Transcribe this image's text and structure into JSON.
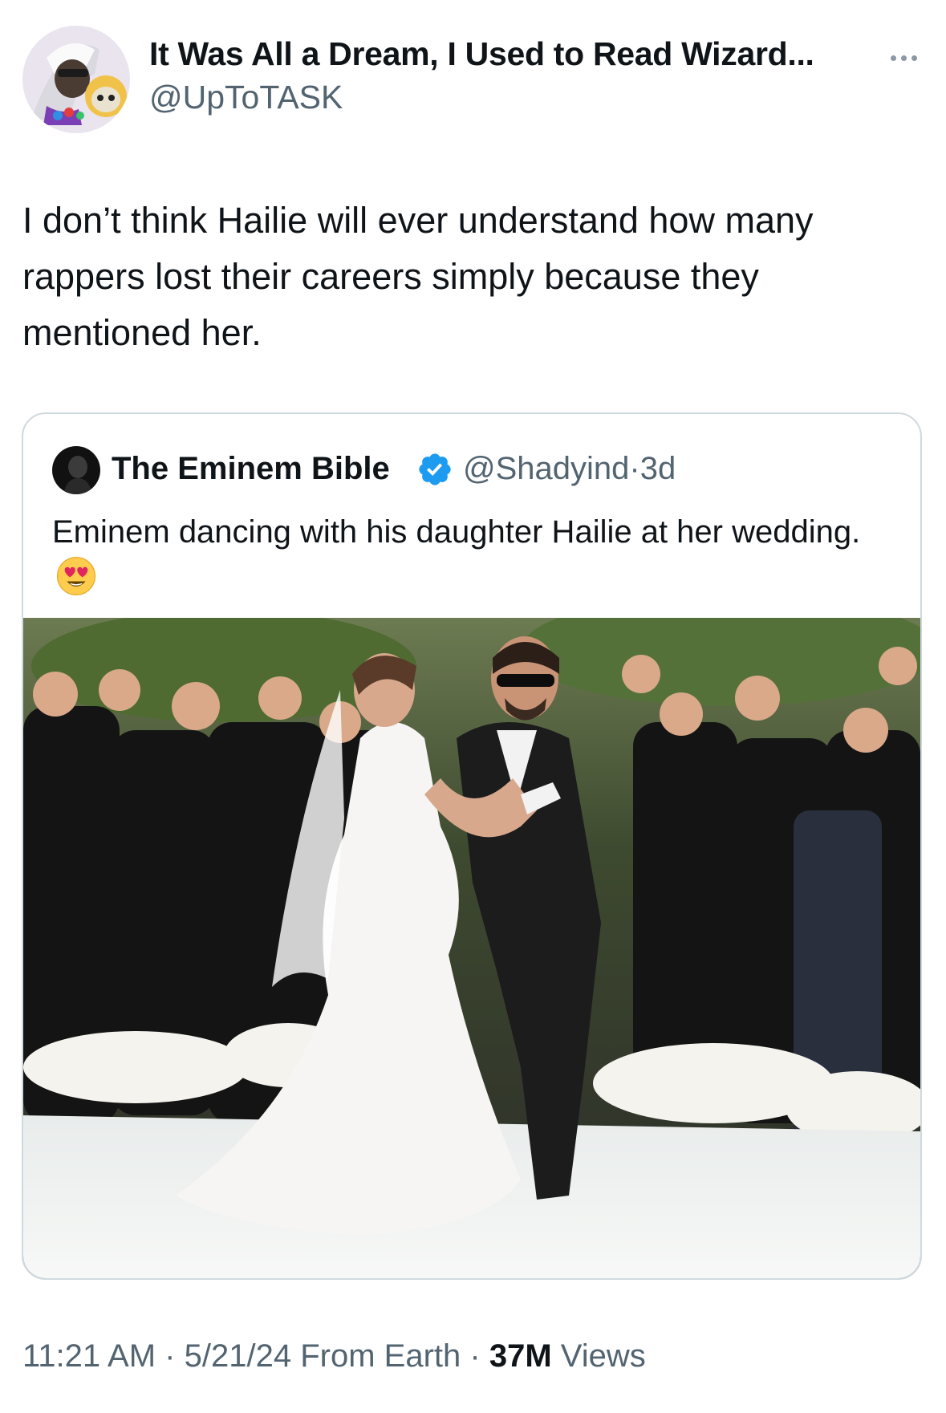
{
  "author": {
    "name": "It Was All a Dream, I Used to Read Wizard...",
    "handle": "@UpToTASK"
  },
  "tweet": {
    "text": "I don’t think Hailie will ever understand how many rappers lost their careers simply because they mentioned her."
  },
  "quoted_tweet": {
    "name": "The Eminem Bible",
    "handle": "@Shadyind",
    "separator": "·",
    "age": "3d",
    "text": "Eminem dancing with his daughter Hailie at her wedding.",
    "emoji": "smiling-face-with-heart-eyes"
  },
  "footer": {
    "time": "11:21 AM",
    "sep1": "·",
    "date": "5/21/24",
    "source": "From Earth",
    "sep2": "·",
    "views_count": "37M",
    "views_label": "Views"
  },
  "colors": {
    "text_primary": "#0f1419",
    "text_secondary": "#536471",
    "verified_blue": "#1d9bf0",
    "card_border": "#cfd9de"
  }
}
